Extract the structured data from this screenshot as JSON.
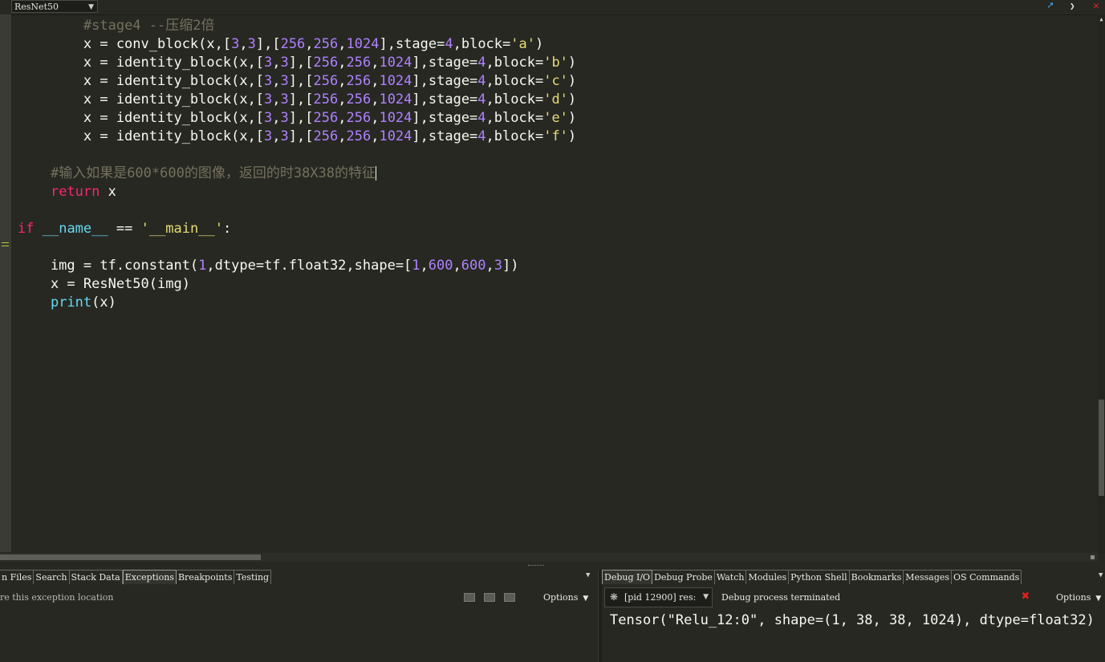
{
  "editor": {
    "scope_value": "ResNet50",
    "lines": [
      [
        {
          "t": "        "
        },
        {
          "t": "#stage4 --压缩2倍",
          "c": "cm"
        }
      ],
      [
        {
          "t": "        x = conv_block(x,["
        },
        {
          "t": "3",
          "c": "num"
        },
        {
          "t": ","
        },
        {
          "t": "3",
          "c": "num"
        },
        {
          "t": "],["
        },
        {
          "t": "256",
          "c": "num"
        },
        {
          "t": ","
        },
        {
          "t": "256",
          "c": "num"
        },
        {
          "t": ","
        },
        {
          "t": "1024",
          "c": "num"
        },
        {
          "t": "],stage="
        },
        {
          "t": "4",
          "c": "num"
        },
        {
          "t": ",block="
        },
        {
          "t": "'a'",
          "c": "str"
        },
        {
          "t": ")"
        }
      ],
      [
        {
          "t": "        x = identity_block(x,["
        },
        {
          "t": "3",
          "c": "num"
        },
        {
          "t": ","
        },
        {
          "t": "3",
          "c": "num"
        },
        {
          "t": "],["
        },
        {
          "t": "256",
          "c": "num"
        },
        {
          "t": ","
        },
        {
          "t": "256",
          "c": "num"
        },
        {
          "t": ","
        },
        {
          "t": "1024",
          "c": "num"
        },
        {
          "t": "],stage="
        },
        {
          "t": "4",
          "c": "num"
        },
        {
          "t": ",block="
        },
        {
          "t": "'b'",
          "c": "str"
        },
        {
          "t": ")"
        }
      ],
      [
        {
          "t": "        x = identity_block(x,["
        },
        {
          "t": "3",
          "c": "num"
        },
        {
          "t": ","
        },
        {
          "t": "3",
          "c": "num"
        },
        {
          "t": "],["
        },
        {
          "t": "256",
          "c": "num"
        },
        {
          "t": ","
        },
        {
          "t": "256",
          "c": "num"
        },
        {
          "t": ","
        },
        {
          "t": "1024",
          "c": "num"
        },
        {
          "t": "],stage="
        },
        {
          "t": "4",
          "c": "num"
        },
        {
          "t": ",block="
        },
        {
          "t": "'c'",
          "c": "str"
        },
        {
          "t": ")"
        }
      ],
      [
        {
          "t": "        x = identity_block(x,["
        },
        {
          "t": "3",
          "c": "num"
        },
        {
          "t": ","
        },
        {
          "t": "3",
          "c": "num"
        },
        {
          "t": "],["
        },
        {
          "t": "256",
          "c": "num"
        },
        {
          "t": ","
        },
        {
          "t": "256",
          "c": "num"
        },
        {
          "t": ","
        },
        {
          "t": "1024",
          "c": "num"
        },
        {
          "t": "],stage="
        },
        {
          "t": "4",
          "c": "num"
        },
        {
          "t": ",block="
        },
        {
          "t": "'d'",
          "c": "str"
        },
        {
          "t": ")"
        }
      ],
      [
        {
          "t": "        x = identity_block(x,["
        },
        {
          "t": "3",
          "c": "num"
        },
        {
          "t": ","
        },
        {
          "t": "3",
          "c": "num"
        },
        {
          "t": "],["
        },
        {
          "t": "256",
          "c": "num"
        },
        {
          "t": ","
        },
        {
          "t": "256",
          "c": "num"
        },
        {
          "t": ","
        },
        {
          "t": "1024",
          "c": "num"
        },
        {
          "t": "],stage="
        },
        {
          "t": "4",
          "c": "num"
        },
        {
          "t": ",block="
        },
        {
          "t": "'e'",
          "c": "str"
        },
        {
          "t": ")"
        }
      ],
      [
        {
          "t": "        x = identity_block(x,["
        },
        {
          "t": "3",
          "c": "num"
        },
        {
          "t": ","
        },
        {
          "t": "3",
          "c": "num"
        },
        {
          "t": "],["
        },
        {
          "t": "256",
          "c": "num"
        },
        {
          "t": ","
        },
        {
          "t": "256",
          "c": "num"
        },
        {
          "t": ","
        },
        {
          "t": "1024",
          "c": "num"
        },
        {
          "t": "],stage="
        },
        {
          "t": "4",
          "c": "num"
        },
        {
          "t": ",block="
        },
        {
          "t": "'f'",
          "c": "str"
        },
        {
          "t": ")"
        }
      ],
      [
        {
          "t": ""
        }
      ],
      [
        {
          "t": "    "
        },
        {
          "t": "#输入如果是600*600的图像，返回的时38X38的特征",
          "c": "cm"
        },
        {
          "t": "|",
          "c": "caret"
        }
      ],
      [
        {
          "t": "    "
        },
        {
          "t": "return",
          "c": "kw"
        },
        {
          "t": " x"
        }
      ],
      [
        {
          "t": ""
        }
      ],
      [
        {
          "t": "if",
          "c": "kw"
        },
        {
          "t": " "
        },
        {
          "t": "__name__",
          "c": "bi"
        },
        {
          "t": " == "
        },
        {
          "t": "'__main__'",
          "c": "str"
        },
        {
          "t": ":"
        }
      ],
      [
        {
          "t": ""
        }
      ],
      [
        {
          "t": "    img = tf.constant("
        },
        {
          "t": "1",
          "c": "num"
        },
        {
          "t": ",dtype=tf.float32,shape=["
        },
        {
          "t": "1",
          "c": "num"
        },
        {
          "t": ","
        },
        {
          "t": "600",
          "c": "num"
        },
        {
          "t": ","
        },
        {
          "t": "600",
          "c": "num"
        },
        {
          "t": ","
        },
        {
          "t": "3",
          "c": "num"
        },
        {
          "t": "])"
        }
      ],
      [
        {
          "t": "    x = ResNet50(img)"
        }
      ],
      [
        {
          "t": "    "
        },
        {
          "t": "print",
          "c": "bi"
        },
        {
          "t": "(x)"
        }
      ]
    ]
  },
  "top_icons": {
    "goto": "goto-definition-icon",
    "dropdown": "chevron-down-icon",
    "close": "close-icon"
  },
  "left_panel": {
    "tabs": [
      "n Files",
      "Search",
      "Stack Data",
      "Exceptions",
      "Breakpoints",
      "Testing"
    ],
    "active_tab": "Exceptions",
    "exception_text": "re this exception location",
    "options_label": "Options"
  },
  "right_panel": {
    "tabs": [
      "Debug I/O",
      "Debug Probe",
      "Watch",
      "Modules",
      "Python Shell",
      "Bookmarks",
      "Messages",
      "OS Commands"
    ],
    "active_tab": "Debug I/O",
    "process_value": "[pid 12900] res:",
    "status": "Debug process terminated",
    "options_label": "Options",
    "output": "Tensor(\"Relu_12:0\", shape=(1, 38, 38, 1024), dtype=float32)"
  },
  "colors": {
    "background": "#272822",
    "keyword": "#f92672",
    "number": "#ae81ff",
    "string": "#e6db74",
    "comment": "#75715e",
    "builtin": "#66d9ef"
  }
}
